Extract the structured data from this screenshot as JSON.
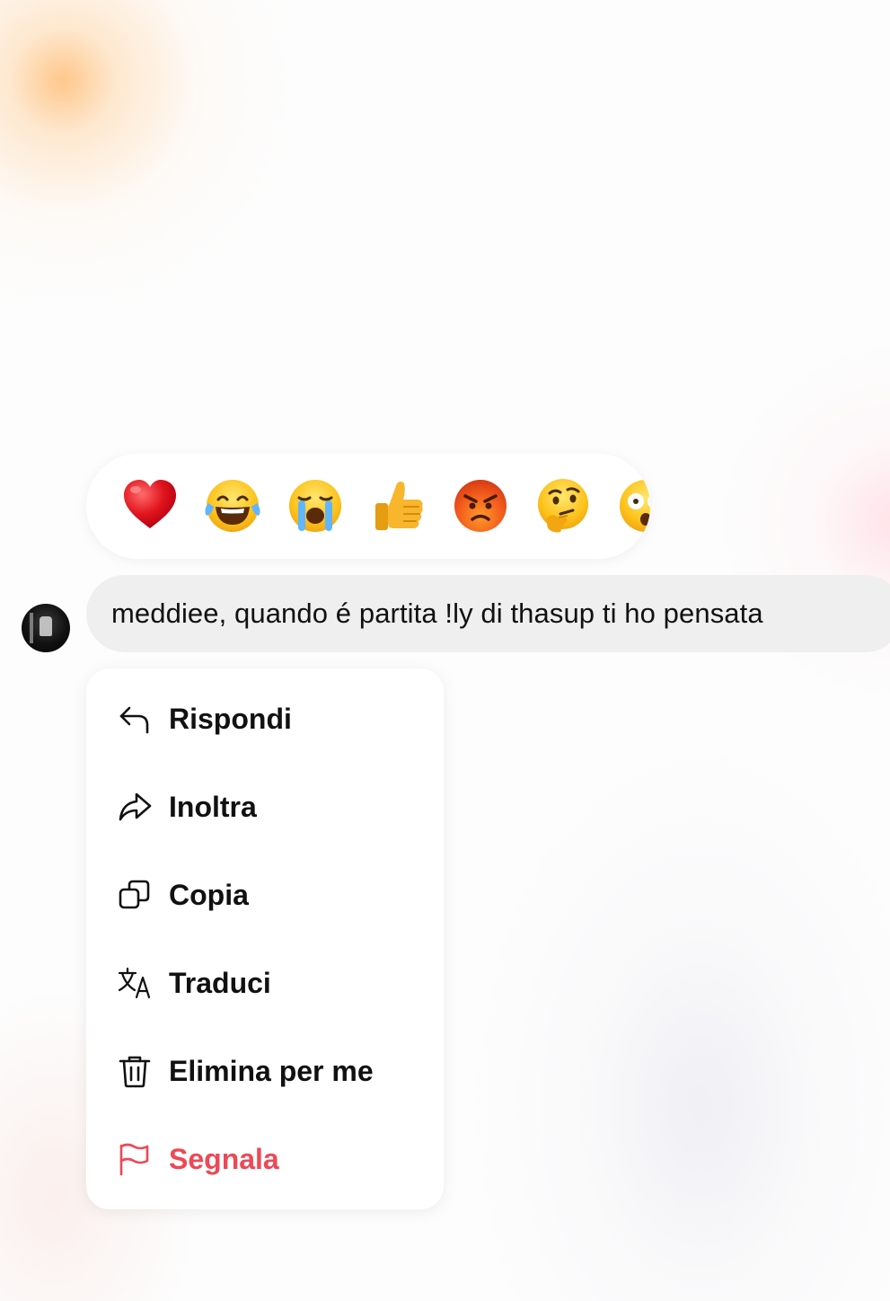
{
  "reactions": [
    {
      "icon": "red-heart-emoji"
    },
    {
      "icon": "tears-of-joy-emoji"
    },
    {
      "icon": "loudly-crying-emoji"
    },
    {
      "icon": "thumbs-up-emoji"
    },
    {
      "icon": "angry-face-emoji"
    },
    {
      "icon": "thinking-face-emoji"
    },
    {
      "icon": "astonished-face-emoji"
    }
  ],
  "message": {
    "text": "meddiee, quando é partita !ly di thasup ti ho pensata"
  },
  "menu": {
    "items": [
      {
        "label": "Rispondi",
        "icon": "reply-icon"
      },
      {
        "label": "Inoltra",
        "icon": "forward-icon"
      },
      {
        "label": "Copia",
        "icon": "copy-icon"
      },
      {
        "label": "Traduci",
        "icon": "translate-icon"
      },
      {
        "label": "Elimina per me",
        "icon": "trash-icon"
      },
      {
        "label": "Segnala",
        "icon": "flag-icon"
      }
    ]
  },
  "colors": {
    "danger": "#ed4956",
    "bubble": "#efefef",
    "text": "#111111"
  }
}
